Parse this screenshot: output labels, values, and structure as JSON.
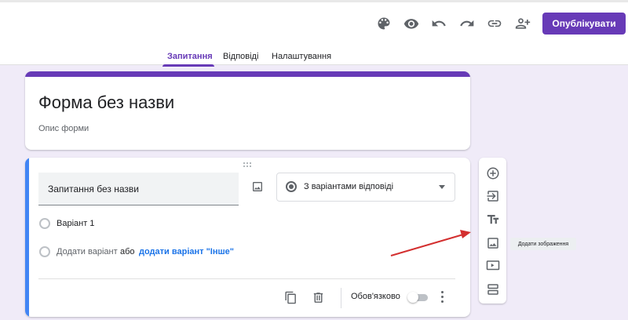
{
  "toolbar": {
    "icons": [
      "palette-icon",
      "eye-icon",
      "undo-icon",
      "redo-icon",
      "link-icon",
      "add-person-icon"
    ],
    "publish_label": "Опублікувати"
  },
  "tabs": [
    {
      "label": "Запитання",
      "active": true
    },
    {
      "label": "Відповіді",
      "active": false
    },
    {
      "label": "Налаштування",
      "active": false
    }
  ],
  "form": {
    "title": "Форма без назви",
    "description": "Опис форми"
  },
  "question": {
    "title": "Запитання без назви",
    "type": "З варіантами відповіді",
    "options": [
      "Варіант 1"
    ],
    "add_option": "Додати варіант",
    "or_text": "або",
    "add_other": "додати варіант \"Інше\"",
    "required_label": "Обов'язково",
    "required": false
  },
  "side_tools": [
    "add-question-icon",
    "import-questions-icon",
    "add-title-icon",
    "add-image-icon",
    "add-video-icon",
    "add-section-icon"
  ],
  "tooltip": "Додати зображення",
  "colors": {
    "accent": "#673ab7",
    "background": "#f0ebf8",
    "active_card": "#4285f4",
    "annotation_arrow": "#d32f2f"
  }
}
